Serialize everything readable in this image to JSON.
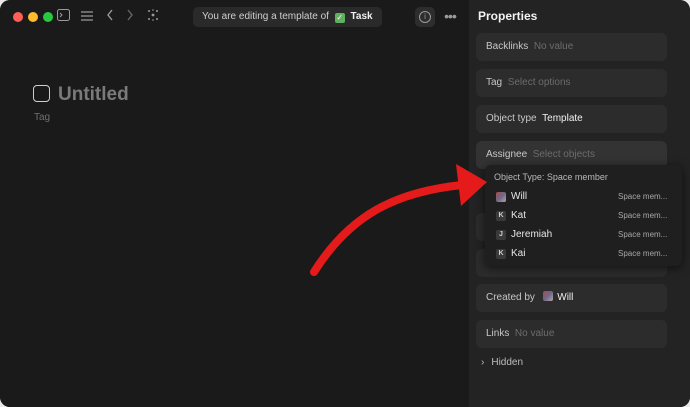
{
  "toolbar": {
    "banner_text": "You are editing a template of",
    "banner_type": "Task"
  },
  "editor": {
    "title": "Untitled",
    "tag_label": "Tag"
  },
  "panel": {
    "title": "Properties",
    "props": [
      {
        "key": "Backlinks",
        "value": "No value"
      },
      {
        "key": "Tag",
        "value": "Select options"
      },
      {
        "key": "Object type",
        "value": "Template"
      },
      {
        "key": "Assignee",
        "value": "Select objects"
      },
      {
        "key": "Created by",
        "value": "Will"
      },
      {
        "key": "Links",
        "value": "No value"
      }
    ],
    "hidden_label": "Hidden"
  },
  "dropdown": {
    "header": "Object Type: Space member",
    "items": [
      {
        "initial": "",
        "name": "Will",
        "meta": "Space mem..."
      },
      {
        "initial": "K",
        "name": "Kat",
        "meta": "Space mem..."
      },
      {
        "initial": "J",
        "name": "Jeremiah",
        "meta": "Space mem..."
      },
      {
        "initial": "K",
        "name": "Kai",
        "meta": "Space mem..."
      }
    ]
  },
  "colors": {
    "accent_check": "#5fb05f",
    "annotation_arrow": "#e51b1b",
    "traffic_red": "#ff5f57",
    "traffic_yellow": "#febc2e",
    "traffic_green": "#28c840"
  }
}
